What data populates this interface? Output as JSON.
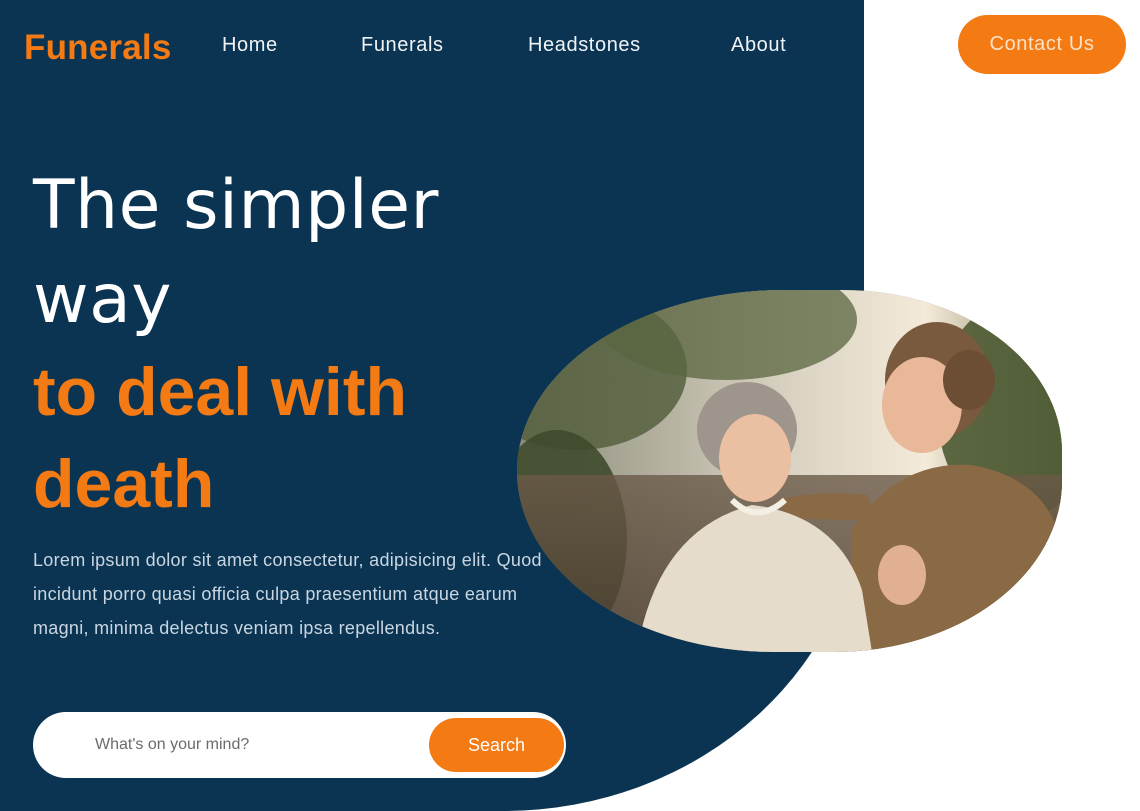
{
  "brand": {
    "logo": "Funerals"
  },
  "nav": {
    "items": [
      {
        "label": "Home"
      },
      {
        "label": "Funerals"
      },
      {
        "label": "Headstones"
      },
      {
        "label": "About"
      }
    ],
    "contact_label": "Contact Us"
  },
  "hero": {
    "line1": "The simpler",
    "line2": "way",
    "line3": "to deal with",
    "line4": "death",
    "description": "Lorem ipsum dolor sit amet consectetur, adipisicing elit. Quod incidunt porro quasi officia culpa praesentium atque earum magni, minima delectus veniam ipsa repellendus."
  },
  "search": {
    "placeholder": "What's on your mind?",
    "button_label": "Search"
  },
  "colors": {
    "navy": "#0a3452",
    "accent": "#f47a14",
    "white": "#ffffff"
  }
}
